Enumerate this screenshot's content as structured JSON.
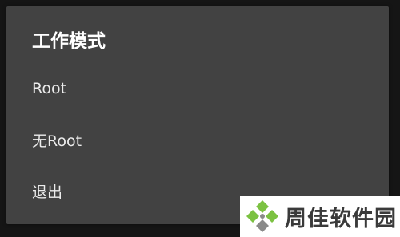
{
  "dialog": {
    "title": "工作模式",
    "options": [
      {
        "label": "Root"
      },
      {
        "label": "无Root"
      },
      {
        "label": "退出"
      }
    ]
  },
  "watermark": {
    "text": "周佳软件园",
    "icon": "site-logo-icon",
    "colors": {
      "green": "#7cc242",
      "gray": "#8a8a8a",
      "text": "#3a3a3a"
    }
  },
  "colors": {
    "background": "#151515",
    "dialog_background": "#424242",
    "title_text": "#ffffff",
    "option_text": "#ececec"
  }
}
